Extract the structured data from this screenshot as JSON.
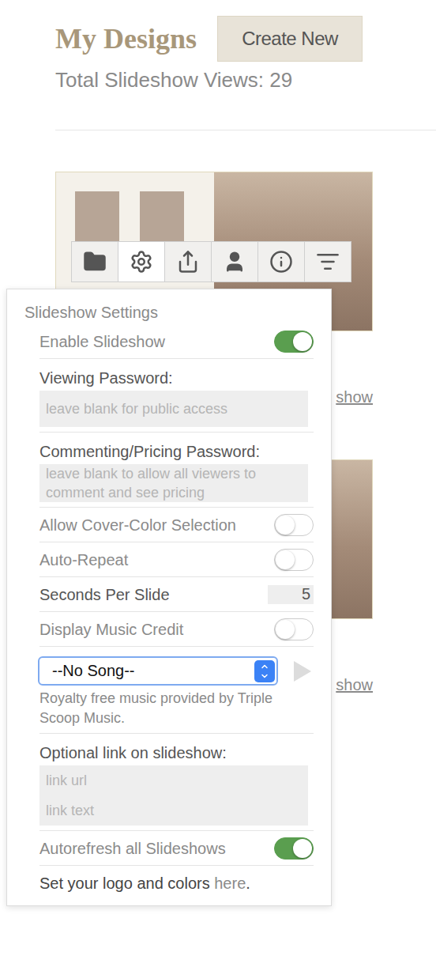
{
  "header": {
    "title": "My Designs",
    "create_button": "Create New",
    "views": "Total Slideshow Views: 29"
  },
  "designs": [
    {
      "link": "show",
      "toolbar_open": true
    },
    {
      "link": "show",
      "toolbar_open": false
    }
  ],
  "toolbar": [
    {
      "icon": "folder",
      "selected": false
    },
    {
      "icon": "gear",
      "selected": true
    },
    {
      "icon": "share",
      "selected": false
    },
    {
      "icon": "person",
      "selected": false
    },
    {
      "icon": "info",
      "selected": false
    },
    {
      "icon": "sort",
      "selected": false
    }
  ],
  "settings": {
    "title": "Slideshow Settings",
    "rows": [
      {
        "kind": "toggle",
        "label": "Enable Slideshow",
        "on": true
      },
      {
        "kind": "field",
        "label": "Viewing Password:",
        "placeholder": "leave blank for public access"
      },
      {
        "kind": "area",
        "label": "Commenting/Pricing Password:",
        "placeholder": "leave blank to allow all viewers to comment and see pricing"
      },
      {
        "kind": "toggle",
        "label": "Allow Cover-Color Selection",
        "on": false
      },
      {
        "kind": "toggle",
        "label": "Auto-Repeat",
        "on": false
      },
      {
        "kind": "number",
        "label": "Seconds Per Slide",
        "value": "5"
      },
      {
        "kind": "toggle",
        "label": "Display Music Credit",
        "on": false
      },
      {
        "kind": "song",
        "value": "--No Song--",
        "focused": true,
        "note": "Royalty free music provided by Triple Scoop Music."
      },
      {
        "kind": "link",
        "label": "Optional link on slideshow:",
        "placeholders": [
          "link url",
          "link text"
        ]
      },
      {
        "kind": "toggle",
        "label": "Autorefresh all Slideshows",
        "on": true
      },
      {
        "kind": "footer",
        "text": "Set your logo and colors ",
        "link": "here",
        "end": "."
      }
    ]
  }
}
